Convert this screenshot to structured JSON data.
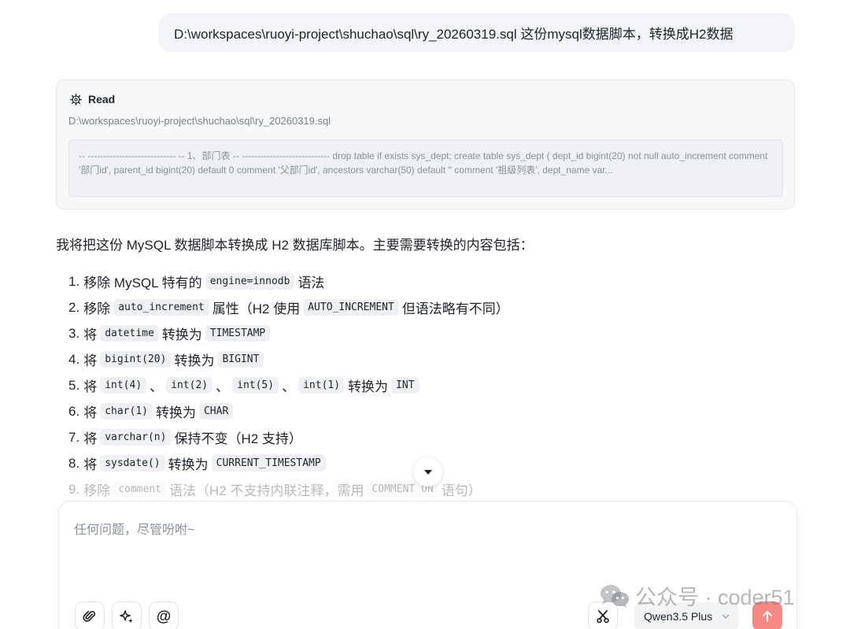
{
  "user_message": "D:\\workspaces\\ruoyi-project\\shuchao\\sql\\ry_20260319.sql 这份mysql数据脚本，转换成H2数据",
  "tool_call": {
    "icon": "gear-icon",
    "title": "Read",
    "path": "D:\\workspaces\\ruoyi-project\\shuchao\\sql\\ry_20260319.sql",
    "preview": "-- ---------------------------- -- 1、部门表 -- ---------------------------- drop table if exists sys_dept; create table sys_dept ( dept_id bigint(20) not null auto_increment comment '部门id', parent_id bigint(20) default 0 comment '父部门id', ancestors varchar(50) default '' comment '祖级列表', dept_name var..."
  },
  "response": {
    "intro": "我将把这份 MySQL 数据脚本转换成 H2 数据库脚本。主要需要转换的内容包括：",
    "steps": [
      {
        "num": "1.",
        "parts": [
          {
            "t": "移除 MySQL 特有的"
          },
          {
            "c": "engine=innodb"
          },
          {
            "t": "语法"
          }
        ]
      },
      {
        "num": "2.",
        "parts": [
          {
            "t": "移除"
          },
          {
            "c": "auto_increment"
          },
          {
            "t": "属性（H2 使用"
          },
          {
            "c": "AUTO_INCREMENT"
          },
          {
            "t": "但语法略有不同）"
          }
        ]
      },
      {
        "num": "3.",
        "parts": [
          {
            "t": "将"
          },
          {
            "c": "datetime"
          },
          {
            "t": "转换为"
          },
          {
            "c": "TIMESTAMP"
          }
        ]
      },
      {
        "num": "4.",
        "parts": [
          {
            "t": "将"
          },
          {
            "c": "bigint(20)"
          },
          {
            "t": "转换为"
          },
          {
            "c": "BIGINT"
          }
        ]
      },
      {
        "num": "5.",
        "parts": [
          {
            "t": "将"
          },
          {
            "c": "int(4)"
          },
          {
            "t": "、"
          },
          {
            "c": "int(2)"
          },
          {
            "t": "、"
          },
          {
            "c": "int(5)"
          },
          {
            "t": "、"
          },
          {
            "c": "int(1)"
          },
          {
            "t": "转换为"
          },
          {
            "c": "INT"
          }
        ]
      },
      {
        "num": "6.",
        "parts": [
          {
            "t": "将"
          },
          {
            "c": "char(1)"
          },
          {
            "t": "转换为"
          },
          {
            "c": "CHAR"
          }
        ]
      },
      {
        "num": "7.",
        "parts": [
          {
            "t": "将"
          },
          {
            "c": "varchar(n)"
          },
          {
            "t": "保持不变（H2 支持）"
          }
        ]
      },
      {
        "num": "8.",
        "parts": [
          {
            "t": "将"
          },
          {
            "c": "sysdate()"
          },
          {
            "t": "转换为"
          },
          {
            "c": "CURRENT_TIMESTAMP"
          }
        ]
      },
      {
        "num": "9.",
        "parts": [
          {
            "t": "移除"
          },
          {
            "c": "comment"
          },
          {
            "t": "语法（H2 不支持内联注释，需用"
          },
          {
            "c": "COMMENT ON"
          },
          {
            "t": "语句）"
          }
        ],
        "faded": true
      }
    ]
  },
  "composer": {
    "placeholder": "任何问题，尽管吩咐~",
    "model": "Qwen3.5 Plus",
    "send_color": "#f48a82"
  },
  "watermark": "公众号 · coder51"
}
